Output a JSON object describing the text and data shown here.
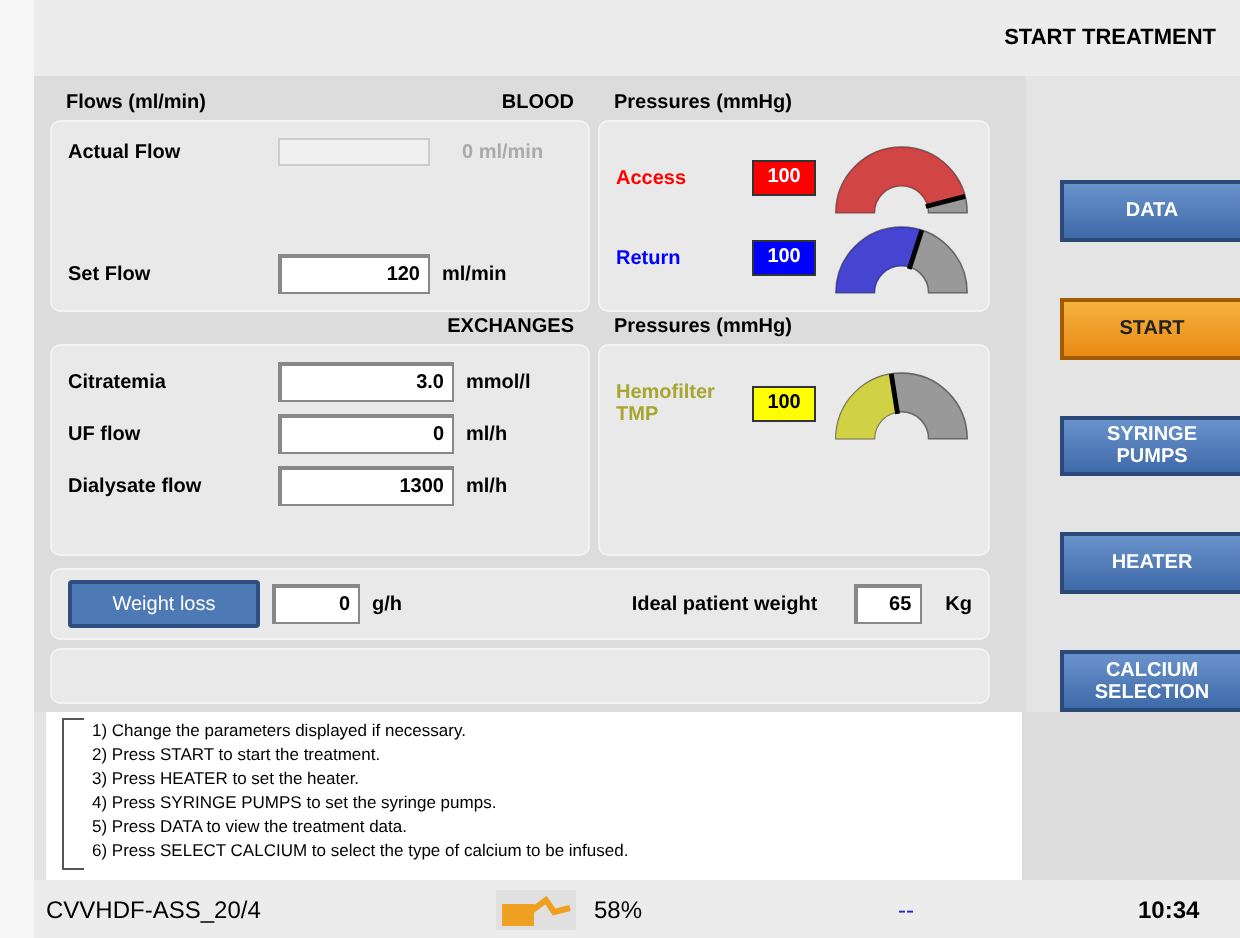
{
  "header": {
    "title": "START TREATMENT"
  },
  "blood": {
    "heading": "Flows (ml/min)",
    "tag": "BLOOD",
    "rows": [
      {
        "label": "Actual Flow",
        "value": "",
        "unit": "0 ml/min",
        "disabled": true
      },
      {
        "label": "Set Flow",
        "value": "120",
        "unit": "ml/min",
        "disabled": false
      }
    ]
  },
  "exchanges": {
    "tag": "EXCHANGES",
    "rows": [
      {
        "label": "Citratemia",
        "value": "3.0",
        "unit": "mmol/l"
      },
      {
        "label": "UF flow",
        "value": "0",
        "unit": "ml/h"
      },
      {
        "label": "Dialysate flow",
        "value": "1300",
        "unit": "ml/h"
      }
    ]
  },
  "pressures": [
    {
      "heading": "Pressures (mmHg)",
      "items": [
        {
          "label": "Access",
          "value": "100",
          "color": "#ff0000",
          "level": 0.92
        },
        {
          "label": "Return",
          "value": "100",
          "color": "#0000ff",
          "level": 0.6
        }
      ]
    },
    {
      "heading": "Pressures (mmHg)",
      "items": [
        {
          "label": "Hemofilter TMP",
          "value": "100",
          "color": "#ffff00",
          "level": 0.45
        }
      ]
    }
  ],
  "weight": {
    "button": "Weight loss",
    "value": "0",
    "unit": "g/h",
    "ideal_label": "Ideal patient weight",
    "ideal_value": "65",
    "ideal_unit": "Kg"
  },
  "instructions": [
    "1) Change the parameters displayed if necessary.",
    "2) Press START to start the treatment.",
    "3) Press HEATER to set the heater.",
    "4) Press SYRINGE PUMPS to set the syringe pumps.",
    "5) Press DATA to view the treatment data.",
    "6) Press SELECT CALCIUM to select the type of calcium to be infused."
  ],
  "side_buttons": [
    {
      "label": "DATA",
      "highlighted": false
    },
    {
      "label": "START",
      "highlighted": true
    },
    {
      "label": "SYRINGE PUMPS",
      "highlighted": false
    },
    {
      "label": "HEATER",
      "highlighted": false
    },
    {
      "label": "CALCIUM SELECTION",
      "highlighted": false
    }
  ],
  "status_bar": {
    "mode": "CVVHDF-ASS_20/4",
    "battery": "58%",
    "indicator": "--",
    "time": "10:34"
  }
}
